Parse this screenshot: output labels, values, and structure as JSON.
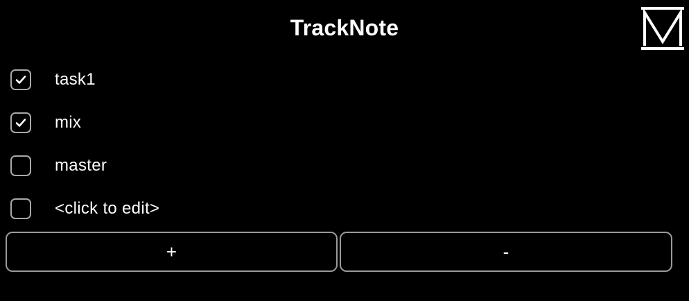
{
  "app": {
    "title": "TrackNote"
  },
  "tasks": [
    {
      "label": "task1",
      "checked": true
    },
    {
      "label": "mix",
      "checked": true
    },
    {
      "label": "master",
      "checked": false
    },
    {
      "label": "<click to edit>",
      "checked": false
    }
  ],
  "buttons": {
    "add_label": "+",
    "remove_label": "-"
  },
  "icons": {
    "logo": "m-logo-icon",
    "check": "checkmark-icon"
  },
  "colors": {
    "background": "#000000",
    "text": "#ffffff",
    "border": "#a9a9a9"
  }
}
